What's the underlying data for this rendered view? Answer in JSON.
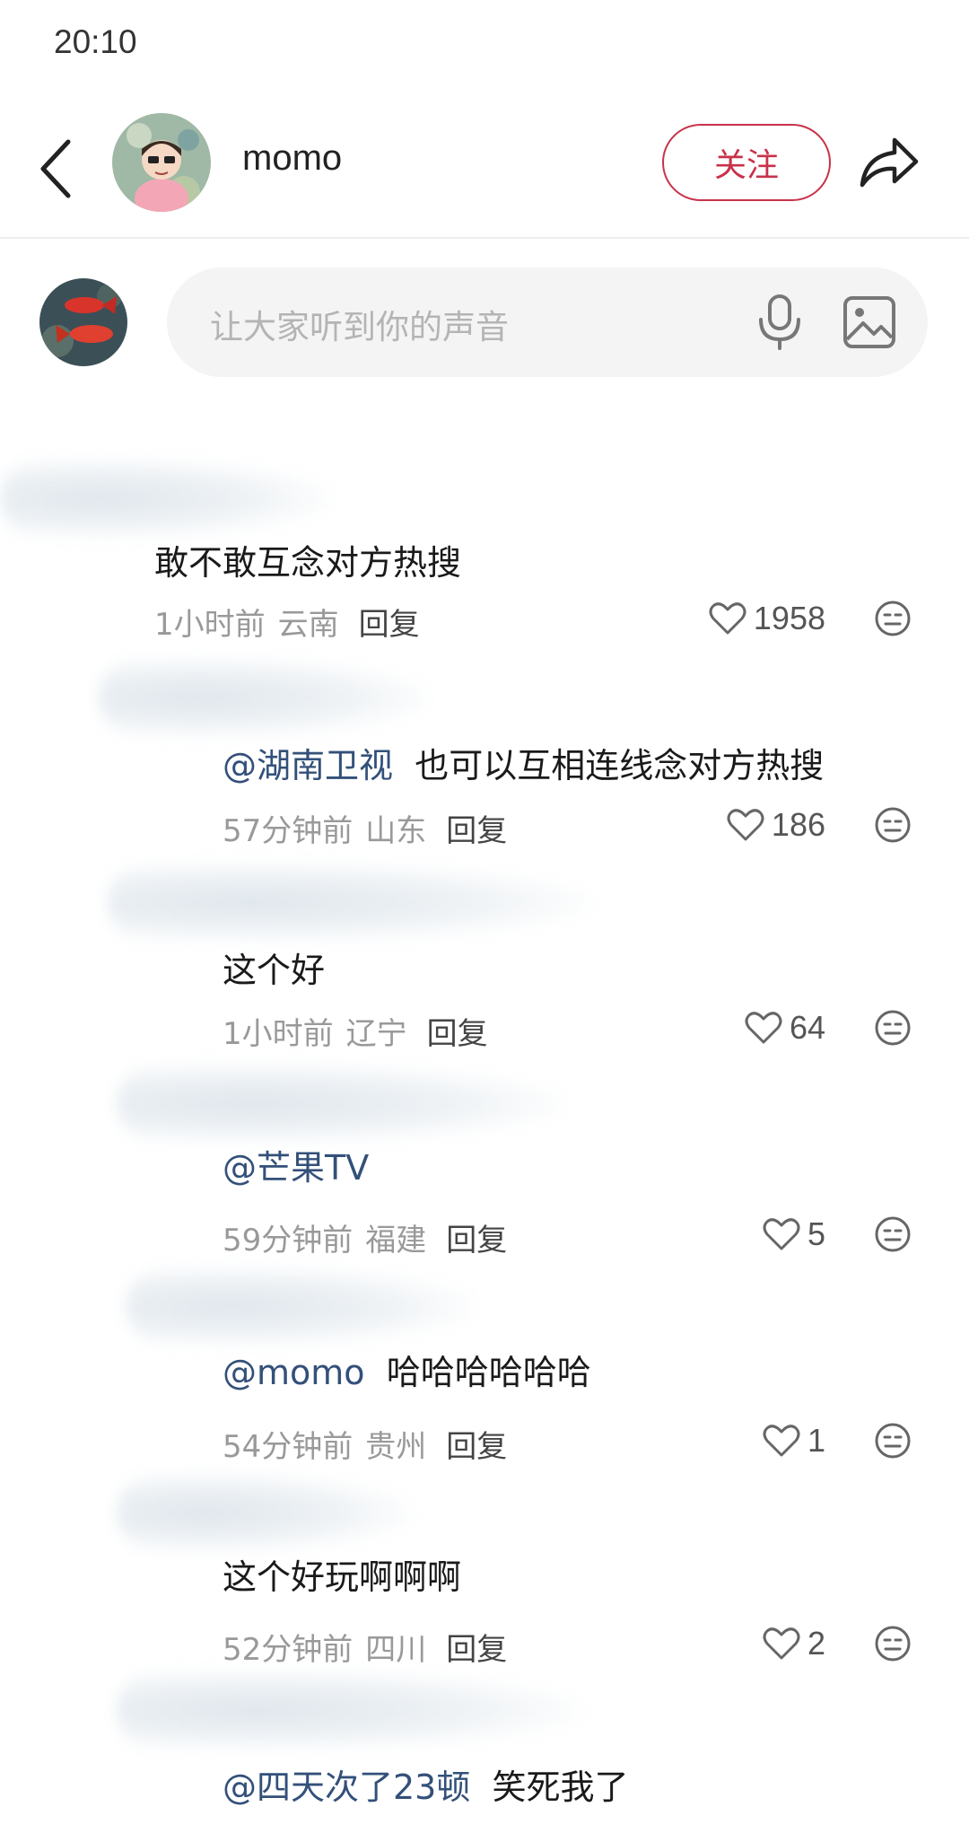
{
  "status_bar": {
    "time": "20:10"
  },
  "header": {
    "author_name": "momo",
    "follow_label": "关注"
  },
  "compose": {
    "placeholder": "让大家听到你的声音"
  },
  "comments": [
    {
      "mention": "",
      "text": "敢不敢互念对方热搜",
      "time": "1小时前",
      "location": "云南",
      "reply": "回复",
      "likes": "1958"
    },
    {
      "mention": "@湖南卫视",
      "text": "也可以互相连线念对方热搜",
      "time": "57分钟前",
      "location": "山东",
      "reply": "回复",
      "likes": "186"
    },
    {
      "mention": "",
      "text": "这个好",
      "time": "1小时前",
      "location": "辽宁",
      "reply": "回复",
      "likes": "64"
    },
    {
      "mention": "@芒果TV",
      "text": "",
      "time": "59分钟前",
      "location": "福建",
      "reply": "回复",
      "likes": "5"
    },
    {
      "mention": "@momo",
      "text": "哈哈哈哈哈哈",
      "time": "54分钟前",
      "location": "贵州",
      "reply": "回复",
      "likes": "1"
    },
    {
      "mention": "",
      "text": "这个好玩啊啊啊",
      "time": "52分钟前",
      "location": "四川",
      "reply": "回复",
      "likes": "2"
    },
    {
      "mention": "@四天次了23顿",
      "text": "笑死我了",
      "time": "",
      "location": "",
      "reply": "",
      "likes": ""
    }
  ],
  "colors": {
    "accent": "#c8324a",
    "mention": "#33507a",
    "meta": "#999999",
    "input_bg": "#f4f4f4"
  }
}
